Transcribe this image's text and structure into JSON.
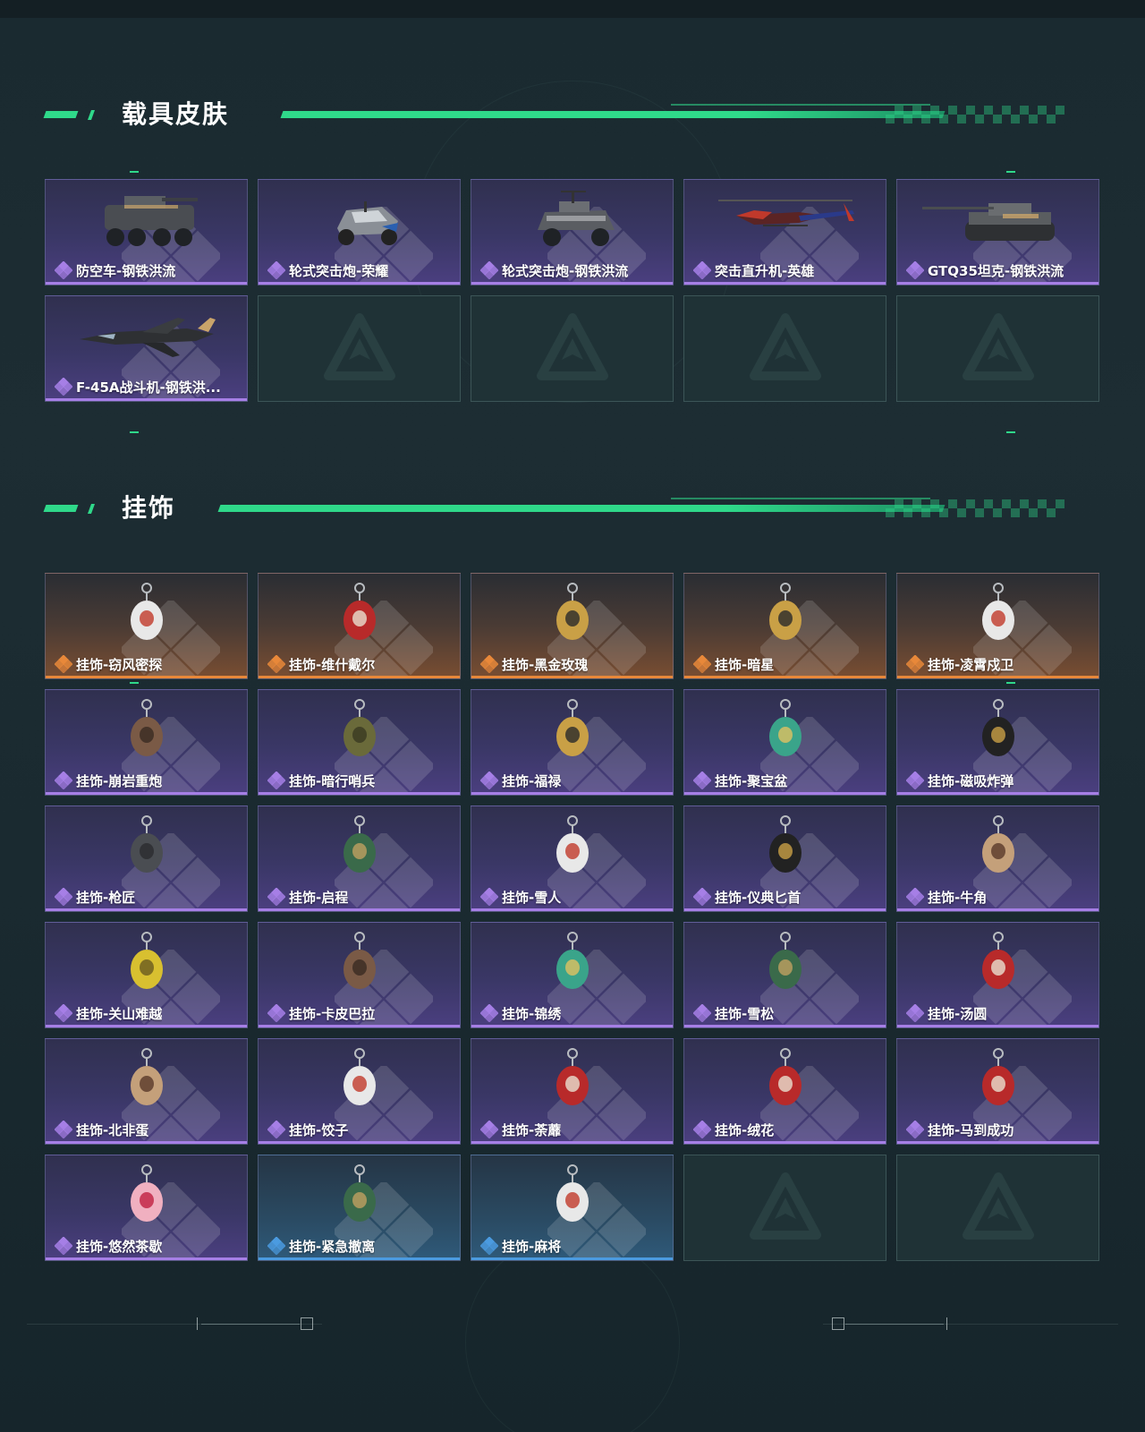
{
  "sections": [
    {
      "title": "载具皮肤",
      "items": [
        {
          "name": "防空车-钢铁洪流",
          "rarity": "purple",
          "art": "apc"
        },
        {
          "name": "轮式突击炮-荣耀",
          "rarity": "purple",
          "art": "buggy"
        },
        {
          "name": "轮式突击炮-钢铁洪流",
          "rarity": "purple",
          "art": "armored-car"
        },
        {
          "name": "突击直升机-英雄",
          "rarity": "purple",
          "art": "helicopter"
        },
        {
          "name": "GTQ35坦克-钢铁洪流",
          "rarity": "purple",
          "art": "tank"
        },
        {
          "name": "F-45A战斗机-钢铁洪...",
          "rarity": "purple",
          "art": "jet"
        },
        {
          "empty": true
        },
        {
          "empty": true
        },
        {
          "empty": true
        },
        {
          "empty": true
        }
      ]
    },
    {
      "title": "挂饰",
      "items": [
        {
          "name": "挂饰-窃风密探",
          "rarity": "orange",
          "art": "charm-white"
        },
        {
          "name": "挂饰-维什戴尔",
          "rarity": "orange",
          "art": "charm-red"
        },
        {
          "name": "挂饰-黑金玫瑰",
          "rarity": "orange",
          "art": "charm-gold"
        },
        {
          "name": "挂饰-暗星",
          "rarity": "orange",
          "art": "charm-gold"
        },
        {
          "name": "挂饰-凌霄戍卫",
          "rarity": "orange",
          "art": "charm-white"
        },
        {
          "name": "挂饰-崩岩重炮",
          "rarity": "purple",
          "art": "charm-brown"
        },
        {
          "name": "挂饰-暗行哨兵",
          "rarity": "purple",
          "art": "charm-olive"
        },
        {
          "name": "挂饰-福禄",
          "rarity": "purple",
          "art": "charm-gold"
        },
        {
          "name": "挂饰-聚宝盆",
          "rarity": "purple",
          "art": "charm-teal"
        },
        {
          "name": "挂饰-磁吸炸弹",
          "rarity": "purple",
          "art": "charm-black"
        },
        {
          "name": "挂饰-枪匠",
          "rarity": "purple",
          "art": "charm-gray"
        },
        {
          "name": "挂饰-启程",
          "rarity": "purple",
          "art": "charm-green"
        },
        {
          "name": "挂饰-雪人",
          "rarity": "purple",
          "art": "charm-white"
        },
        {
          "name": "挂饰-仪典匕首",
          "rarity": "purple",
          "art": "charm-black"
        },
        {
          "name": "挂饰-牛角",
          "rarity": "purple",
          "art": "charm-tan"
        },
        {
          "name": "挂饰-关山难越",
          "rarity": "purple",
          "art": "charm-yellow"
        },
        {
          "name": "挂饰-卡皮巴拉",
          "rarity": "purple",
          "art": "charm-brown"
        },
        {
          "name": "挂饰-锦绣",
          "rarity": "purple",
          "art": "charm-teal"
        },
        {
          "name": "挂饰-雪松",
          "rarity": "purple",
          "art": "charm-green"
        },
        {
          "name": "挂饰-汤圆",
          "rarity": "purple",
          "art": "charm-red"
        },
        {
          "name": "挂饰-北非蛋",
          "rarity": "purple",
          "art": "charm-tan"
        },
        {
          "name": "挂饰-饺子",
          "rarity": "purple",
          "art": "charm-white"
        },
        {
          "name": "挂饰-荼蘼",
          "rarity": "purple",
          "art": "charm-red"
        },
        {
          "name": "挂饰-绒花",
          "rarity": "purple",
          "art": "charm-red"
        },
        {
          "name": "挂饰-马到成功",
          "rarity": "purple",
          "art": "charm-red"
        },
        {
          "name": "挂饰-悠然茶歇",
          "rarity": "purple",
          "art": "charm-pink"
        },
        {
          "name": "挂饰-紧急撤离",
          "rarity": "blue",
          "art": "charm-green"
        },
        {
          "name": "挂饰-麻将",
          "rarity": "blue",
          "art": "charm-white"
        },
        {
          "empty": true
        },
        {
          "empty": true
        }
      ]
    }
  ],
  "colors": {
    "accent": "#2fd98a",
    "purple": "#a67fe6",
    "orange": "#e8883a",
    "blue": "#4b9be0"
  }
}
